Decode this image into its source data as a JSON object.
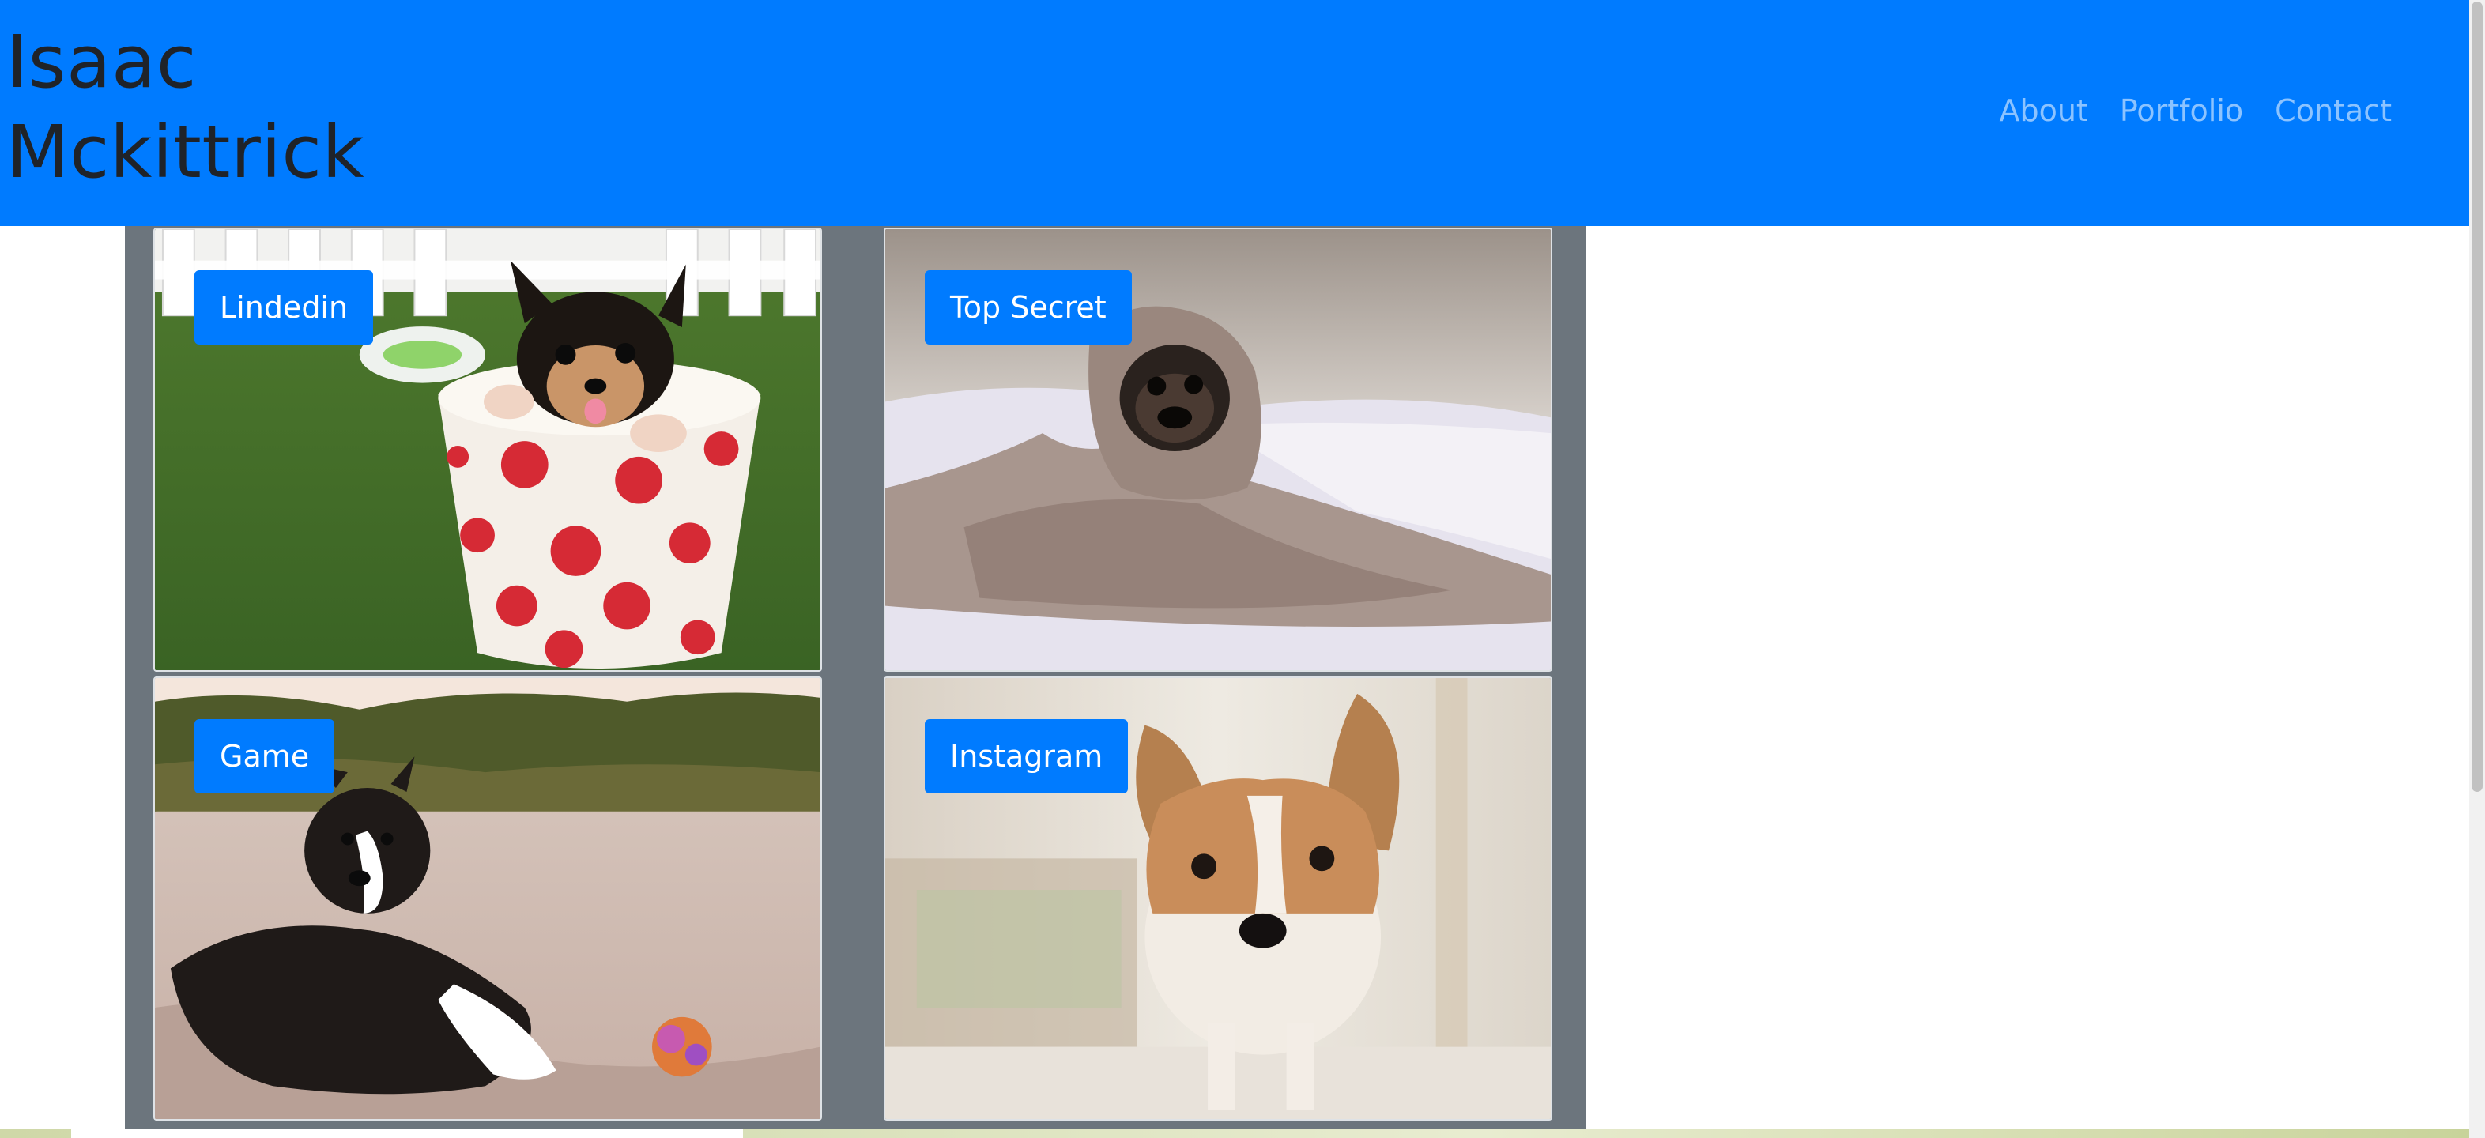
{
  "brand": {
    "line1": "Isaac",
    "line2": "Mckittrick"
  },
  "nav": {
    "links": [
      "About",
      "Portfolio",
      "Contact"
    ]
  },
  "portfolio": {
    "cards": [
      {
        "label": "Lindedin",
        "image": "puppy-in-polka-dot-cup"
      },
      {
        "label": "Top Secret",
        "image": "pug-wrapped-in-blanket"
      },
      {
        "label": "Game",
        "image": "puppy-lying-on-sand-with-ball"
      },
      {
        "label": "Instagram",
        "image": "corgi-puppy-standing"
      }
    ]
  },
  "colors": {
    "navbar": "#007bff",
    "button": "#007bff",
    "grid_background": "#6c757d",
    "nav_link": "rgba(255,255,255,0.55)"
  }
}
